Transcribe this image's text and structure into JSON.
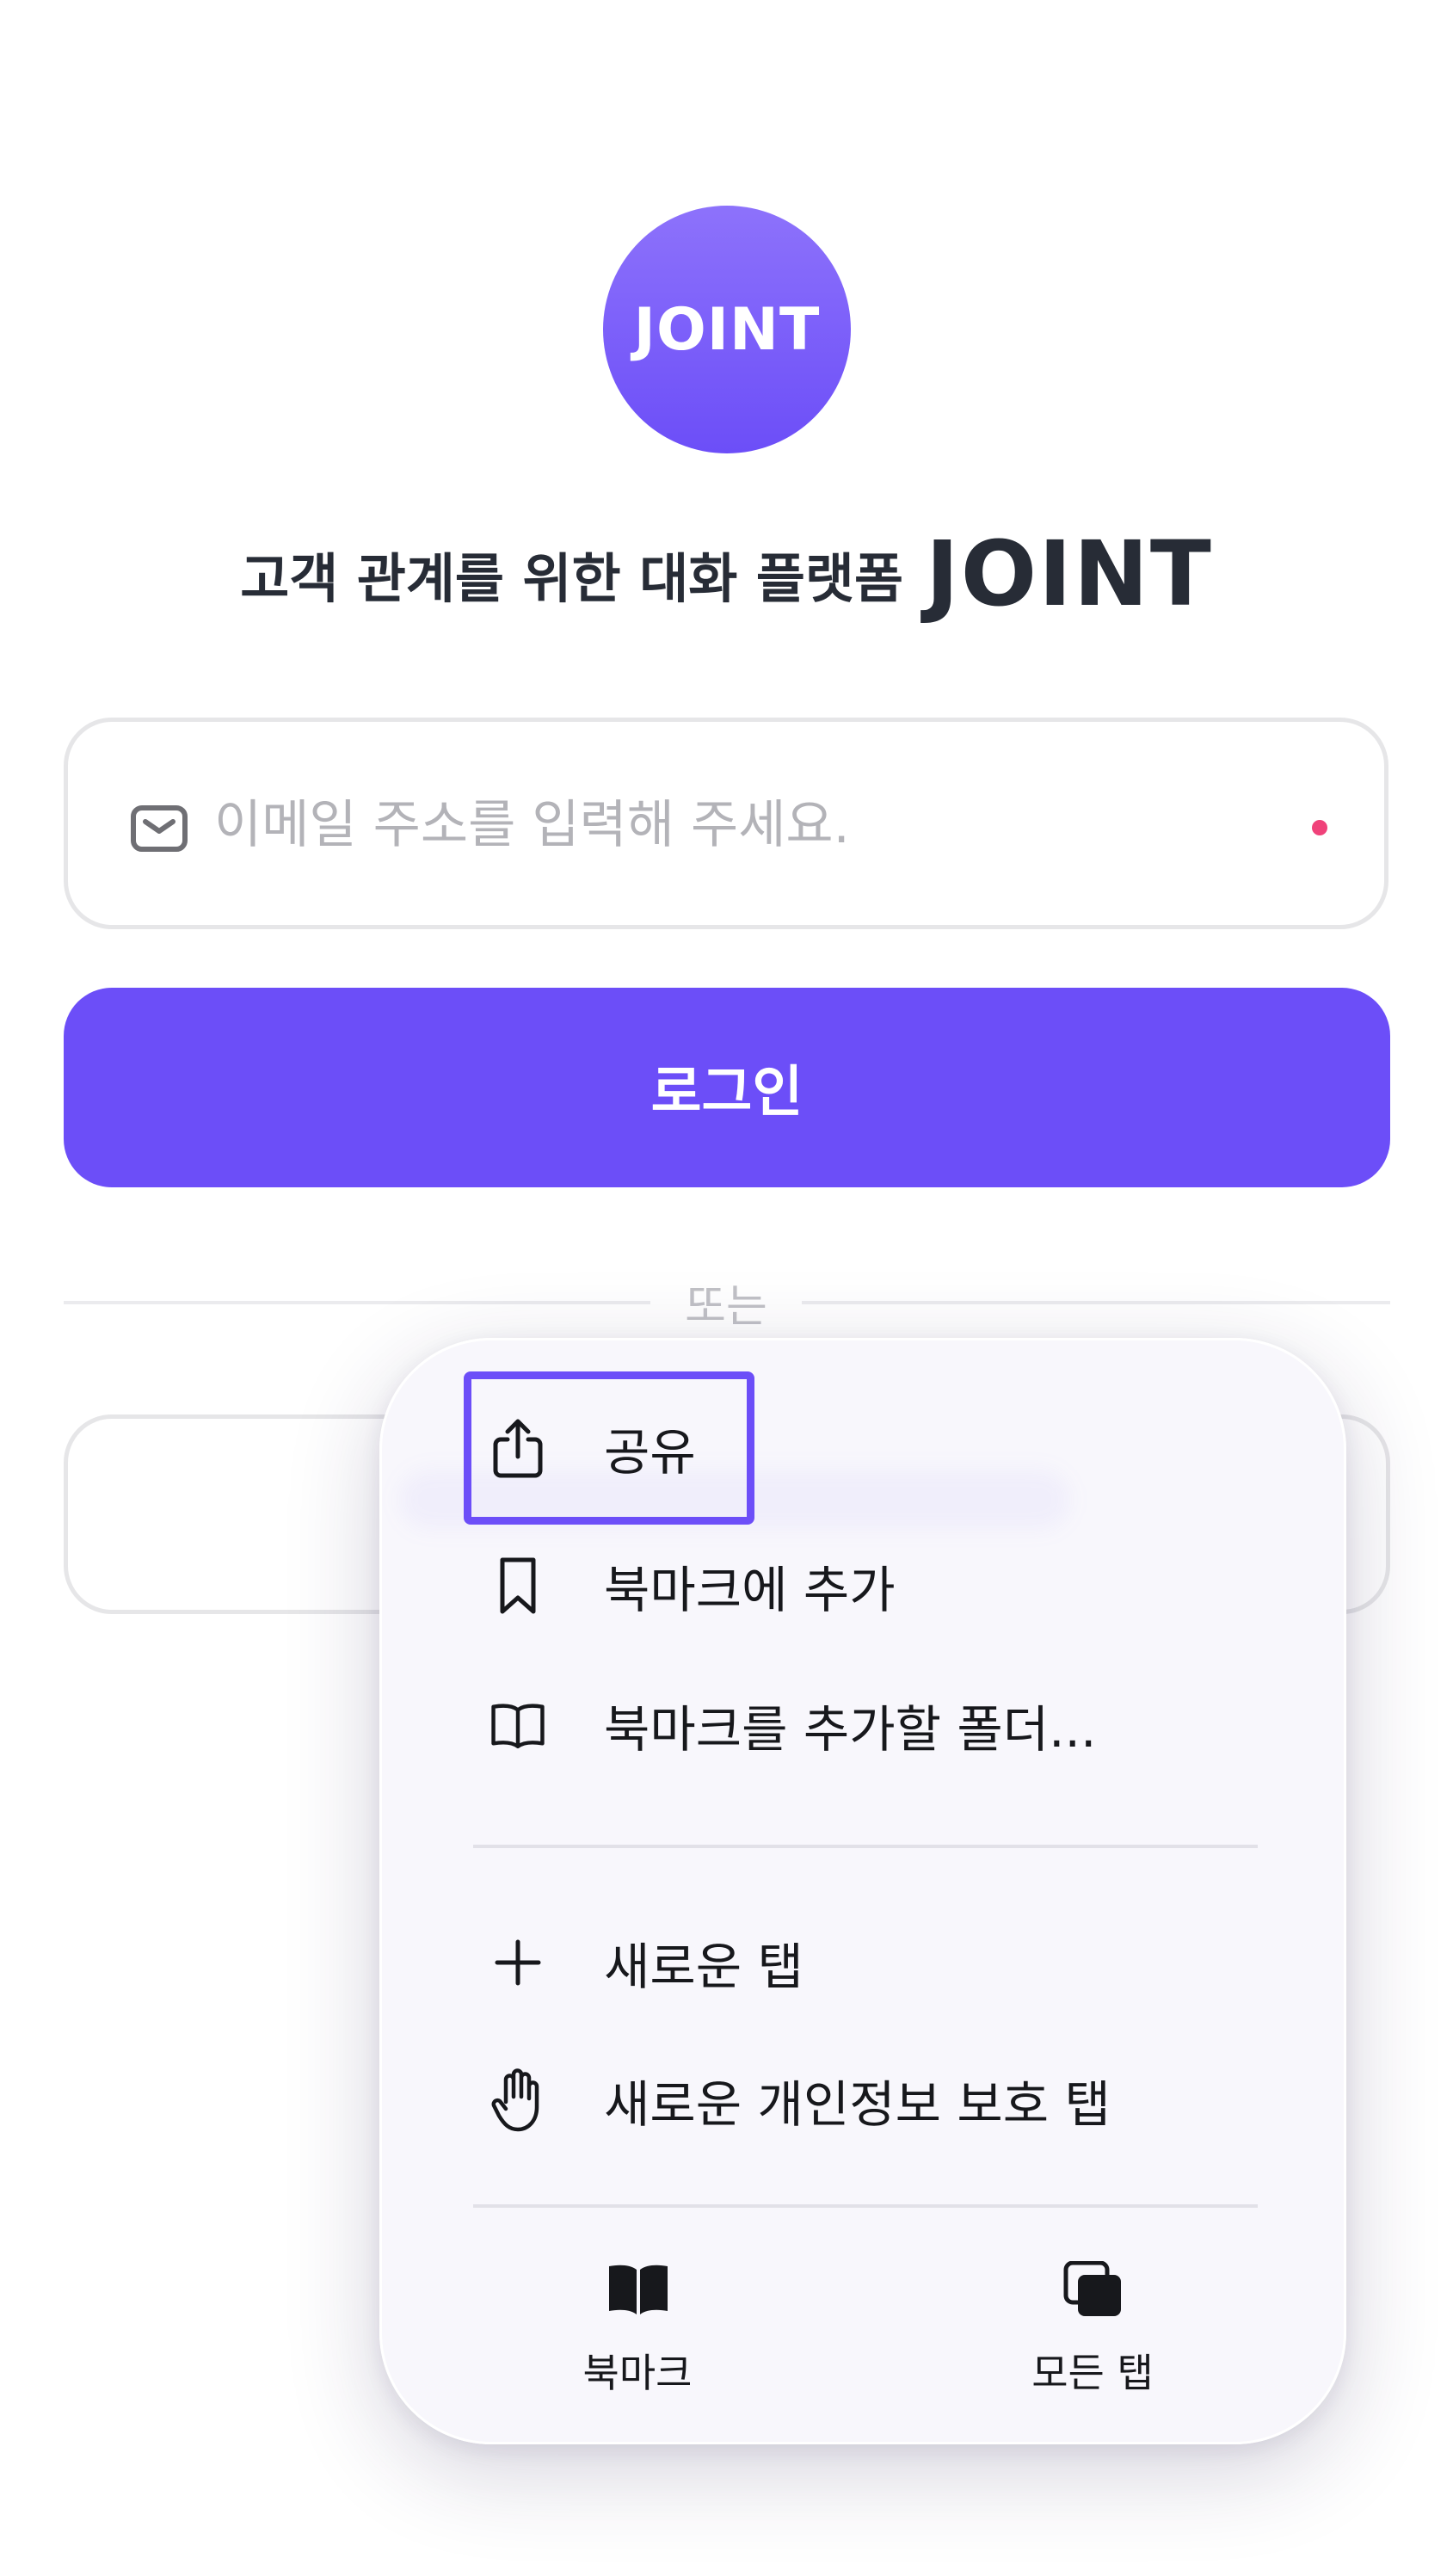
{
  "brand": {
    "logo_text": "JOINT",
    "tagline": "고객 관계를 위한 대화 플랫폼",
    "tagline_brand": "JOINT",
    "accent_color": "#6c4ef8"
  },
  "login": {
    "email_placeholder": "이메일 주소를 입력해 주세요.",
    "email_value": "",
    "login_label": "로그인",
    "divider_text": "또는"
  },
  "menu": {
    "items": [
      {
        "label": "공유",
        "icon": "share-icon"
      },
      {
        "label": "북마크에 추가",
        "icon": "bookmark-icon"
      },
      {
        "label": "북마크를 추가할 폴더...",
        "icon": "book-open-icon"
      },
      {
        "label": "새로운 탭",
        "icon": "plus-icon"
      },
      {
        "label": "새로운 개인정보 보호 탭",
        "icon": "hand-icon"
      }
    ],
    "bottom": [
      {
        "label": "북마크",
        "icon": "book-filled-icon"
      },
      {
        "label": "모든 탭",
        "icon": "tabs-icon"
      }
    ]
  }
}
